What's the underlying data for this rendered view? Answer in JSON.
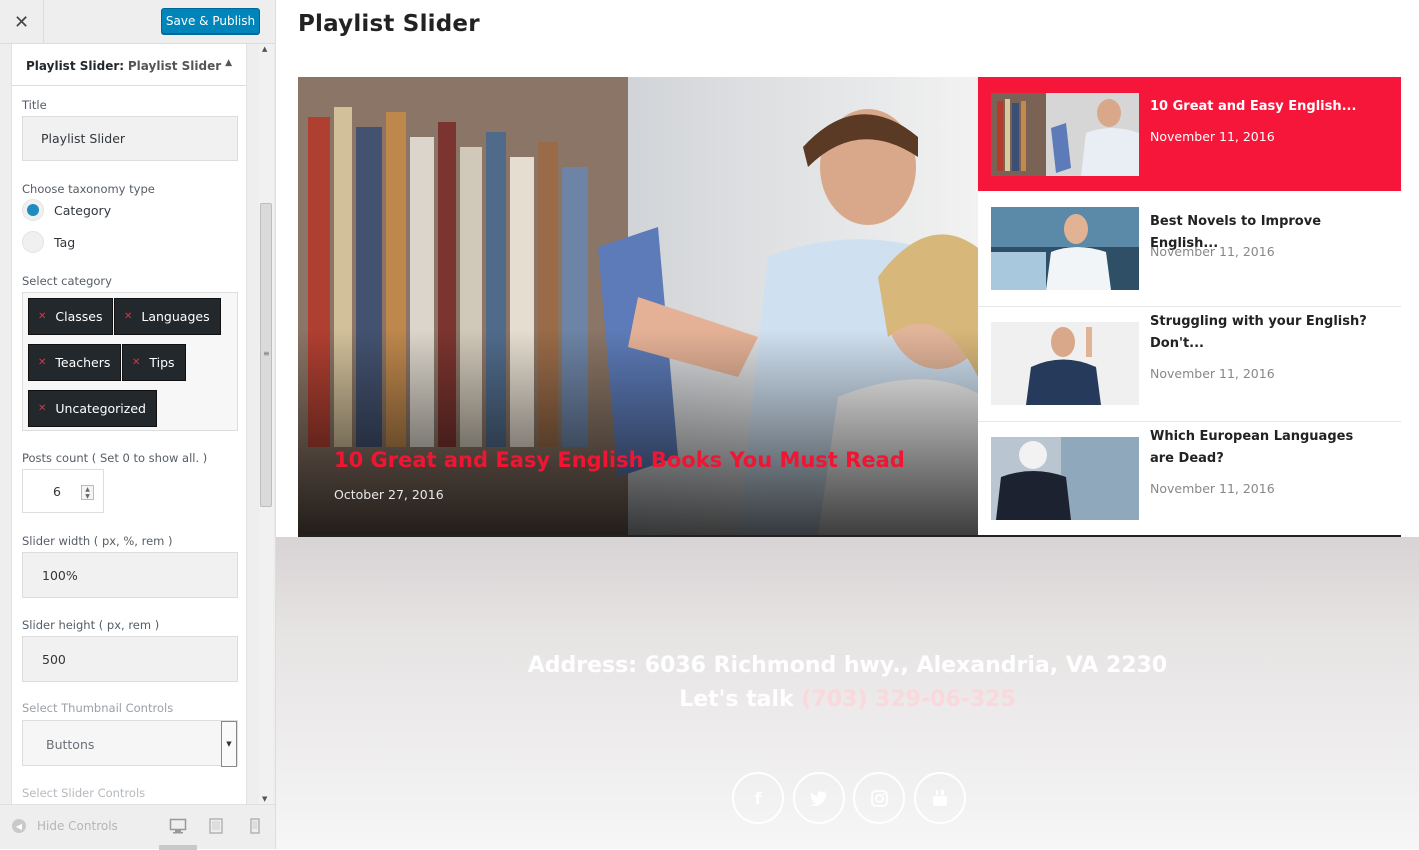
{
  "sidebar": {
    "close_icon": "close-icon",
    "save_label": "Save & Publish",
    "section_prefix": "Playlist Slider:",
    "section_title": "Playlist Slider",
    "title_label": "Title",
    "title_value": "Playlist Slider",
    "taxonomy_label": "Choose taxonomy type",
    "taxonomy_options": [
      "Category",
      "Tag"
    ],
    "taxonomy_selected": "Category",
    "category_label": "Select category",
    "categories": [
      "Classes",
      "Languages",
      "Teachers",
      "Tips",
      "Uncategorized"
    ],
    "posts_count_label": "Posts count ( Set 0 to show all. )",
    "posts_count_value": "6",
    "slider_width_label": "Slider width ( px, %, rem )",
    "slider_width_value": "100%",
    "slider_height_label": "Slider height ( px, rem )",
    "slider_height_value": "500",
    "thumb_controls_label": "Select Thumbnail Controls",
    "thumb_controls_value": "Buttons",
    "slider_controls_label": "Select Slider Controls",
    "hide_controls_label": "Hide Controls"
  },
  "preview": {
    "page_title": "Playlist Slider",
    "hero": {
      "title": "10 Great and Easy English Books You Must Read",
      "date": "October 27, 2016"
    },
    "items": [
      {
        "title": "10 Great and Easy English...",
        "date": "November 11, 2016"
      },
      {
        "title": "Best Novels to Improve English...",
        "date": "November 11, 2016"
      },
      {
        "title": "Struggling with your English? Don't...",
        "date": "November 11, 2016"
      },
      {
        "title": "Which European Languages are Dead?",
        "date": "November 11, 2016"
      }
    ],
    "footer": {
      "address": "Address: 6036 Richmond hwy., Alexandria, VA 2230",
      "talk_label": "Let's talk",
      "phone": "(703) 329-06-325",
      "social": [
        "facebook-icon",
        "twitter-icon",
        "instagram-icon",
        "youtube-icon"
      ]
    }
  },
  "colors": {
    "accent": "#f5163a",
    "primary_button": "#0085ba"
  }
}
